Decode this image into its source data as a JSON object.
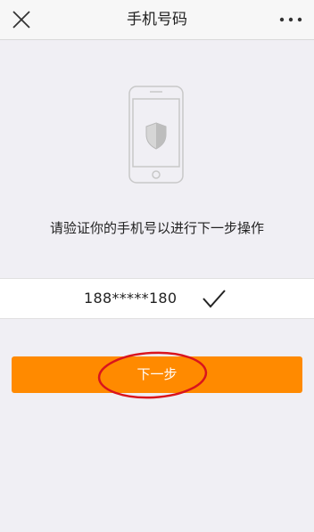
{
  "header": {
    "title": "手机号码",
    "close_icon": "close-icon",
    "more_icon": "more-icon"
  },
  "illustration": {
    "icon": "phone-shield-icon"
  },
  "prompt": "请验证你的手机号以进行下一步操作",
  "phone": {
    "number": "188*****180",
    "status_icon": "check-icon"
  },
  "actions": {
    "next_label": "下一步"
  },
  "colors": {
    "accent": "#ff8a00",
    "annotation": "#d9141d",
    "background": "#f0eff4"
  }
}
